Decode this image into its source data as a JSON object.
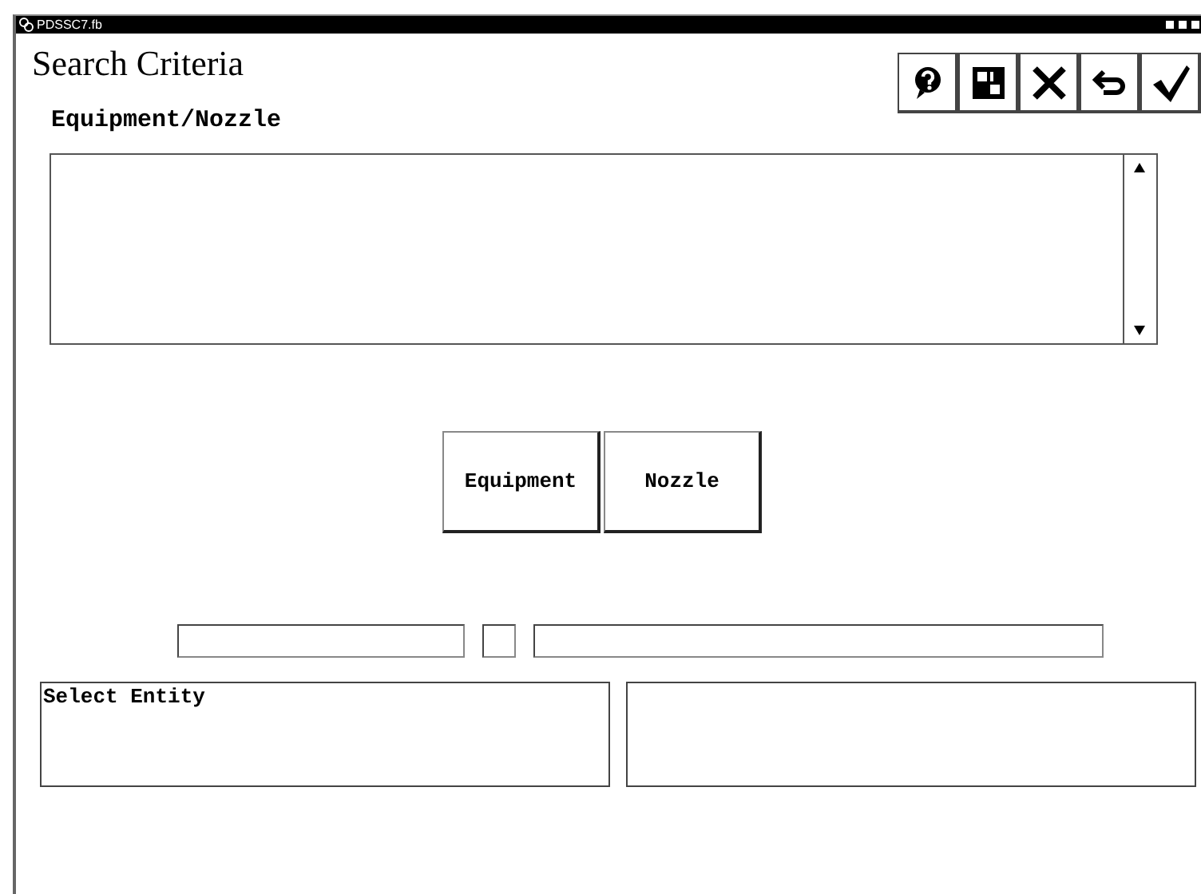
{
  "window": {
    "title": "PDSSC7.fb"
  },
  "heading": "Search Criteria",
  "toolbar": [
    {
      "kind": "help"
    },
    {
      "kind": "form"
    },
    {
      "kind": "cancel"
    },
    {
      "kind": "undo"
    },
    {
      "kind": "accept"
    }
  ],
  "list_label": "Equipment/Nozzle",
  "buttons": [
    "Equipment",
    "Nozzle"
  ],
  "message_pane": {
    "text": "Select Entity"
  }
}
